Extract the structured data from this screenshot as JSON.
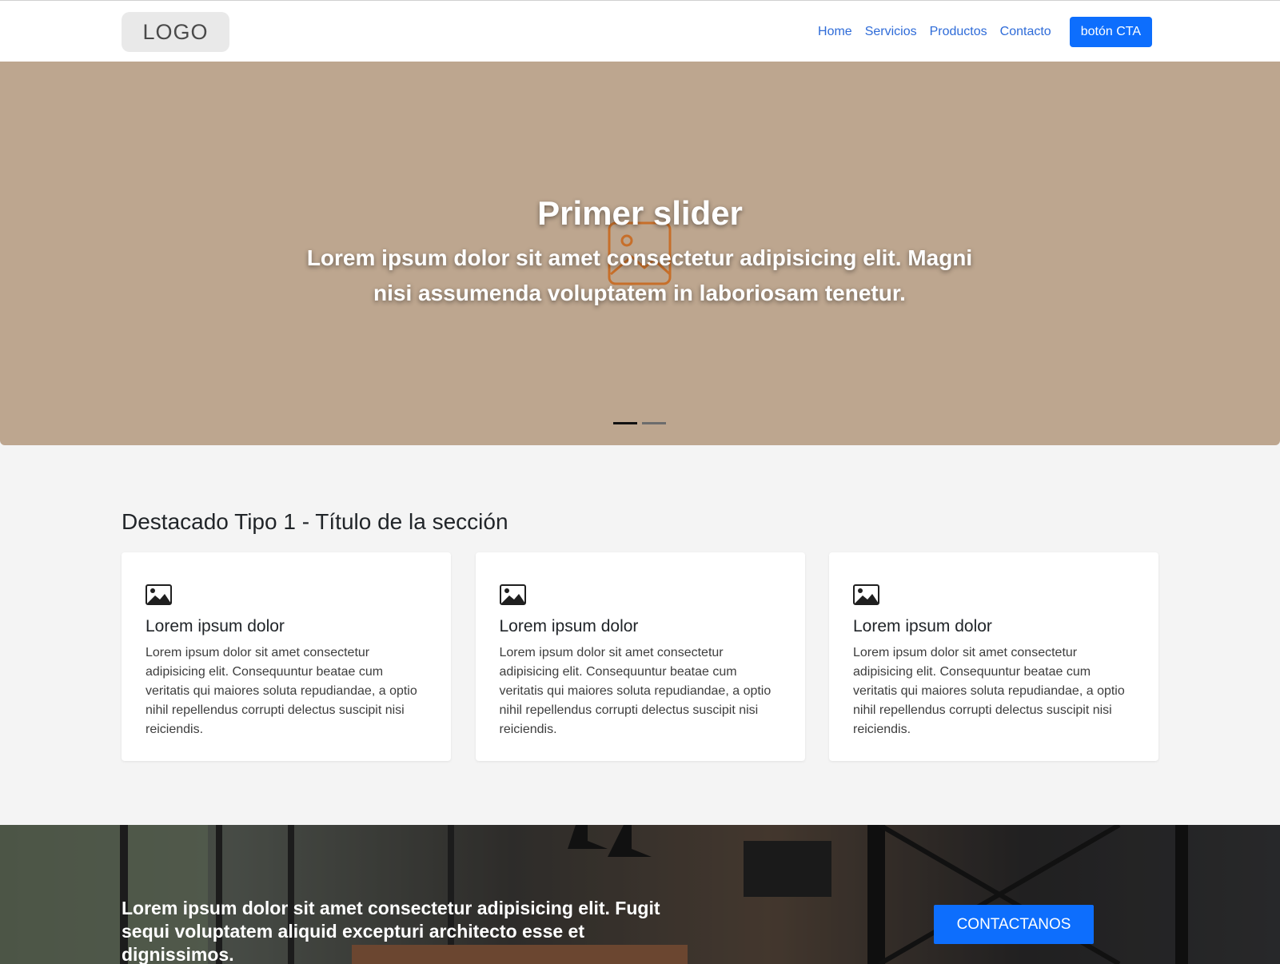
{
  "header": {
    "logo": "LOGO",
    "nav": [
      "Home",
      "Servicios",
      "Productos",
      "Contacto"
    ],
    "cta_label": "botón CTA"
  },
  "hero": {
    "title": "Primer slider",
    "subtitle": "Lorem ipsum dolor sit amet consectetur adipisicing elit. Magni nisi assumenda voluptatem in laboriosam tenetur.",
    "background_color": "#bda68f",
    "slides_count": 2,
    "active_slide": 1
  },
  "featured": {
    "title": "Destacado Tipo 1 - Título de la sección",
    "cards": [
      {
        "icon": "image-icon",
        "title": "Lorem ipsum dolor",
        "text": "Lorem ipsum dolor sit amet consectetur adipisicing elit. Consequuntur beatae cum veritatis qui maiores soluta repudiandae, a optio nihil repellendus corrupti delectus suscipit nisi reiciendis."
      },
      {
        "icon": "image-icon",
        "title": "Lorem ipsum dolor",
        "text": "Lorem ipsum dolor sit amet consectetur adipisicing elit. Consequuntur beatae cum veritatis qui maiores soluta repudiandae, a optio nihil repellendus corrupti delectus suscipit nisi reiciendis."
      },
      {
        "icon": "image-icon",
        "title": "Lorem ipsum dolor",
        "text": "Lorem ipsum dolor sit amet consectetur adipisicing elit. Consequuntur beatae cum veritatis qui maiores soluta repudiandae, a optio nihil repellendus corrupti delectus suscipit nisi reiciendis."
      }
    ]
  },
  "banner": {
    "text": "Lorem ipsum dolor sit amet consectetur adipisicing elit. Fugit sequi voluptatem aliquid excepturi architecto esse et dignissimos.",
    "button_label": "CONTACTANOS"
  },
  "colors": {
    "primary": "#0d6efd",
    "nav_link": "#2e6bd8",
    "page_bg": "#f4f4f4",
    "placeholder_icon": "#c76f2a"
  }
}
